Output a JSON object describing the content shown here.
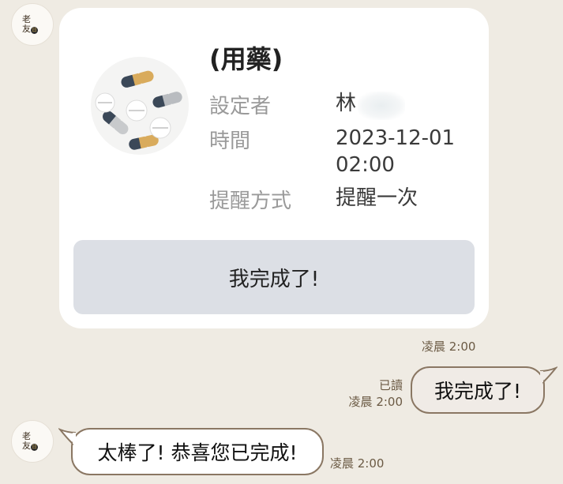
{
  "bot": {
    "avatar_icon": "laoyou-logo-icon",
    "avatar_text": "老友",
    "avatar_seal": "日"
  },
  "reminder": {
    "title": "(用藥)",
    "image_icon": "pills-icon",
    "setter_label": "設定者",
    "setter_value": "林",
    "time_label": "時間",
    "time_value": "2023-12-01 02:00",
    "mode_label": "提醒方式",
    "mode_value": "提醒一次",
    "done_button_label": "我完成了!",
    "timestamp": "凌晨 2:00"
  },
  "user_message": {
    "read_status": "已讀",
    "timestamp": "凌晨 2:00",
    "text": "我完成了!"
  },
  "bot_reply": {
    "text": "太棒了! 恭喜您已完成!",
    "timestamp": "凌晨 2:00"
  },
  "colors": {
    "background": "#efebe3",
    "card": "#ffffff",
    "button": "#dcdfe5",
    "bubble_border": "#8a7763",
    "timestamp": "#6b5a44"
  }
}
